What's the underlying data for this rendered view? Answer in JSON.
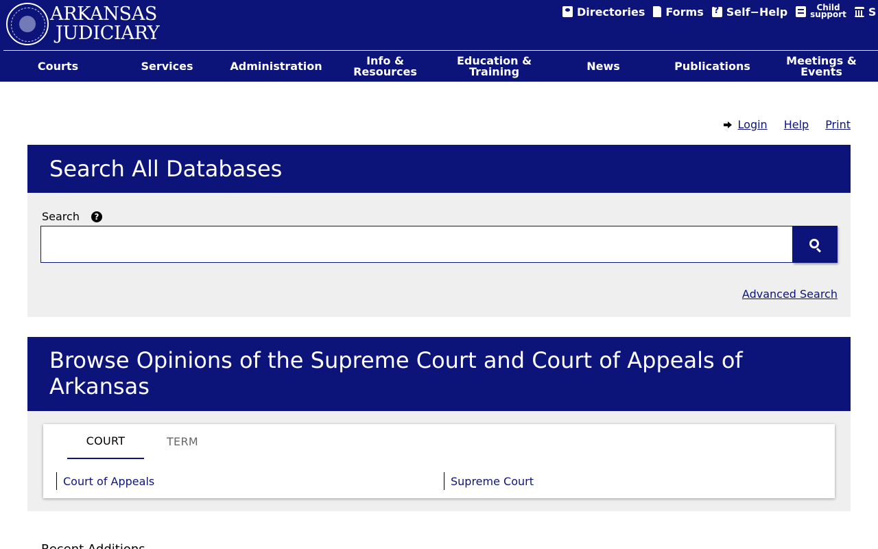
{
  "header": {
    "brand_line1": "ARKANSAS",
    "brand_line2": "JUDICIARY",
    "utility_links": {
      "directories": "Directories",
      "forms": "Forms",
      "self_help": "Self−Help",
      "child_support_1": "Child",
      "child_support_2": "support",
      "trailing": "S"
    }
  },
  "nav": {
    "courts": "Courts",
    "services": "Services",
    "administration": "Administration",
    "info_1": "Info &",
    "info_2": "Resources",
    "edu_1": "Education &",
    "edu_2": "Training",
    "news": "News",
    "publications": "Publications",
    "meet_1": "Meetings &",
    "meet_2": "Events"
  },
  "tools": {
    "login": "Login",
    "help": "Help",
    "print": "Print"
  },
  "search": {
    "title": "Search All Databases",
    "label": "Search",
    "help_glyph": "?",
    "input_value": "",
    "advanced": "Advanced Search"
  },
  "browse": {
    "title": "Browse Opinions of the Supreme Court and Court of Appeals of Arkansas",
    "tabs": [
      "COURT",
      "TERM"
    ],
    "courts": [
      "Court of Appeals",
      "Supreme Court"
    ]
  },
  "recent": {
    "title": "Recent Additions"
  },
  "colors": {
    "brand_navy": "#0c1479",
    "panel_gray": "#efefef"
  }
}
